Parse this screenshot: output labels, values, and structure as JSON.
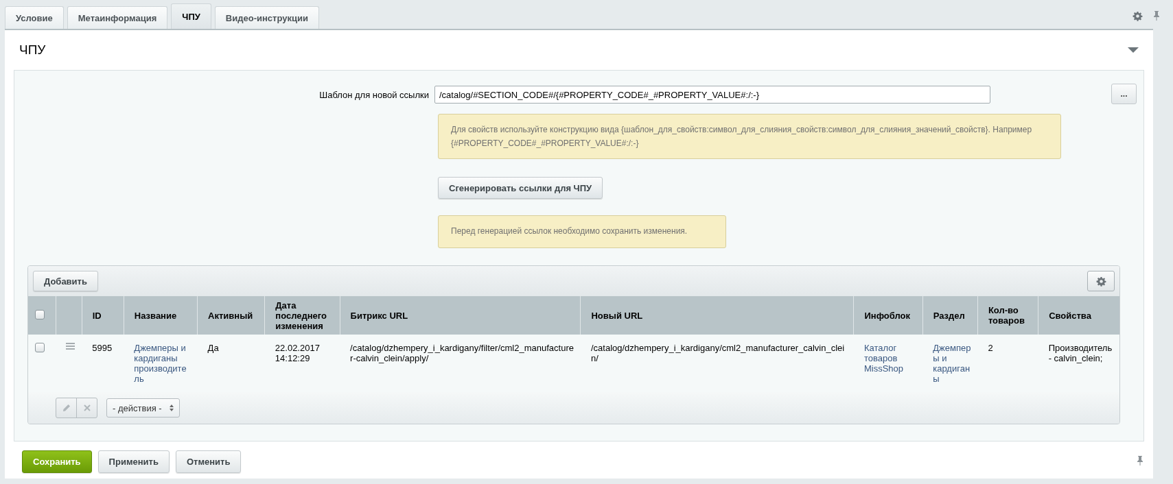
{
  "tabs": [
    {
      "label": "Условие",
      "selected": false
    },
    {
      "label": "Метаинформация",
      "selected": false
    },
    {
      "label": "ЧПУ",
      "selected": true
    },
    {
      "label": "Видео-инструкции",
      "selected": false
    }
  ],
  "section": {
    "title": "ЧПУ",
    "expanded": true
  },
  "template_field": {
    "label": "Шаблон для новой ссылки",
    "value": "/catalog/#SECTION_CODE#/{#PROPERTY_CODE#_#PROPERTY_VALUE#:/:-}",
    "more_button": "..."
  },
  "hint": "Для свойств используйте конструкцию вида {шаблон_для_свойств:символ_для_слияния_свойств:символ_для_слияния_значений_свойств}. Например {#PROPERTY_CODE#_#PROPERTY_VALUE#:/:-}",
  "generate_button": "Сгенерировать ссылки для ЧПУ",
  "warning": "Перед генерацией ссылок необходимо сохранить изменения.",
  "grid": {
    "add_button": "Добавить",
    "select_all_checked": false,
    "columns": [
      "ID",
      "Название",
      "Активный",
      "Дата последнего изменения",
      "Битрикс URL",
      "Новый URL",
      "Инфоблок",
      "Раздел",
      "Кол-во товаров",
      "Свойства"
    ],
    "rows": [
      {
        "checked": false,
        "cells": [
          {
            "kind": "text",
            "text": "5995"
          },
          {
            "kind": "link",
            "text": "Джемперы и кардиганы производитель"
          },
          {
            "kind": "text",
            "text": "Да"
          },
          {
            "kind": "text",
            "text": "22.02.2017 14:12:29"
          },
          {
            "kind": "text",
            "text": "/catalog/dzhempery_i_kardigany/filter/cml2_manufacturer-calvin_clein/apply/"
          },
          {
            "kind": "text",
            "text": "/catalog/dzhempery_i_kardigany/cml2_manufacturer_calvin_clein/"
          },
          {
            "kind": "link",
            "text": "Каталог товаров MissShop"
          },
          {
            "kind": "link",
            "text": "Джемперы и кардиганы"
          },
          {
            "kind": "text",
            "text": "2"
          },
          {
            "kind": "text",
            "text": "Производитель - calvin_clein;"
          }
        ]
      }
    ],
    "actions_select": "- действия -"
  },
  "footer_buttons": [
    {
      "label": "Сохранить",
      "kind": "primary"
    },
    {
      "label": "Применить",
      "kind": "normal"
    },
    {
      "label": "Отменить",
      "kind": "normal"
    }
  ]
}
